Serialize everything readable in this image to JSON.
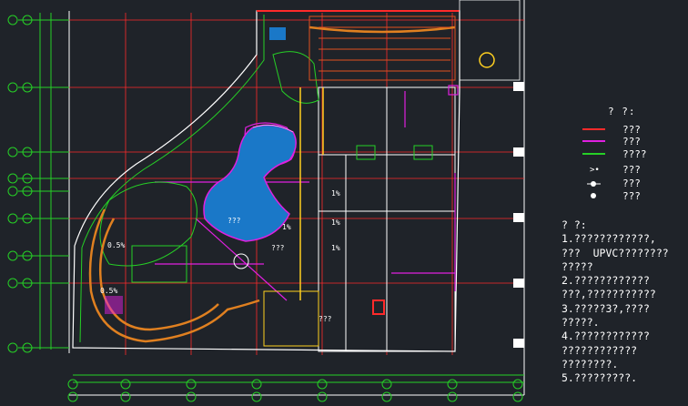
{
  "legend": {
    "title": "? ?:",
    "items": [
      {
        "color": "#ff2a2a",
        "label": "???",
        "symbol": "line"
      },
      {
        "color": "#e020e0",
        "label": "???",
        "symbol": "line"
      },
      {
        "color": "#26d026",
        "label": "????",
        "symbol": "line"
      },
      {
        "color": "#ffffff",
        "label": "???",
        "symbol": "fixture"
      },
      {
        "color": "#ffffff",
        "label": "???",
        "symbol": "spot"
      },
      {
        "color": "#ffffff",
        "label": "???",
        "symbol": "dot"
      }
    ]
  },
  "notes": {
    "lines": [
      "? ?:",
      "1.????????????,",
      "???  UPVC????????",
      "?????",
      "2.????????????",
      "???,???????????",
      "3.?????3?,????",
      "?????.",
      "4.????????????",
      "????????????",
      "????????.",
      "5.?????????."
    ]
  },
  "plan": {
    "labels": {
      "pool": "???",
      "plaza": "???",
      "deck": "???",
      "slope_a": "0.5%",
      "slope_b": "0.5%",
      "slope_c": "1%",
      "slope_d": "1%",
      "slope_e": "1%",
      "slope_f": "1%"
    }
  }
}
